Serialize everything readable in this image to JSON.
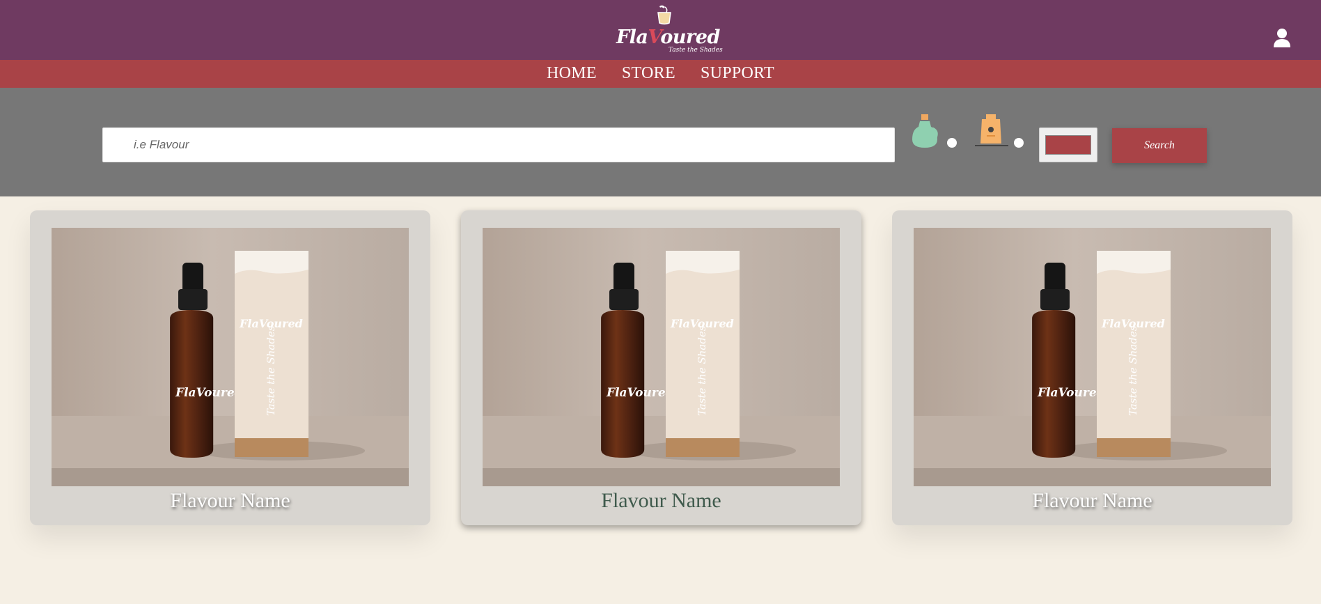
{
  "header": {
    "logo_word_a": "Fla",
    "logo_word_v": "V",
    "logo_word_b": "oured",
    "logo_tagline": "Taste the Shades",
    "brand_color": "#6f3a61",
    "user_icon": "user-icon"
  },
  "nav": {
    "items": [
      {
        "label": "HOME"
      },
      {
        "label": "STORE"
      },
      {
        "label": "SUPPORT"
      }
    ],
    "color": "#a94347"
  },
  "search": {
    "placeholder": "i.e Flavour",
    "value": "",
    "bottle_options": [
      {
        "icon": "oil-bottle-icon"
      },
      {
        "icon": "box-bottle-icon"
      }
    ],
    "color_value": "#a94347",
    "button_label": "Search"
  },
  "cards": [
    {
      "title": "Flavour Name",
      "bottle_label": "FlaVoured",
      "box_text": "Taste the Shades"
    },
    {
      "title": "Flavour Name",
      "bottle_label": "FlaVoured",
      "box_text": "Taste the Shades"
    },
    {
      "title": "Flavour Name",
      "bottle_label": "FlaVoured",
      "box_text": "Taste the Shades"
    }
  ]
}
